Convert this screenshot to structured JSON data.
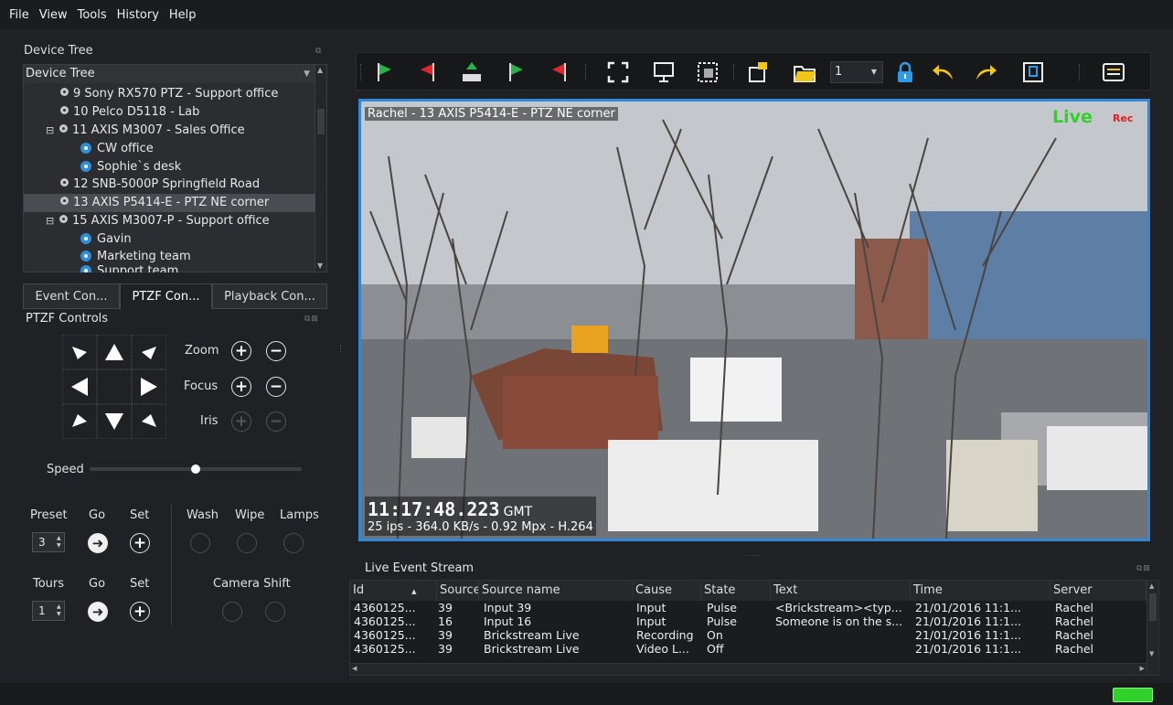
{
  "menu": [
    "File",
    "View",
    "Tools",
    "History",
    "Help"
  ],
  "device_tree": {
    "panel_title": "Device Tree",
    "header": "Device Tree",
    "items": [
      {
        "label": "9 Sony RX570 PTZ - Support office",
        "type": "camera",
        "level": 1
      },
      {
        "label": "10 Pelco D5118 - Lab",
        "type": "camera",
        "level": 1
      },
      {
        "label": "11 AXIS M3007 - Sales Office",
        "type": "camera",
        "level": 1,
        "expanded": true
      },
      {
        "label": "CW office",
        "type": "view",
        "level": 2
      },
      {
        "label": "Sophie`s desk",
        "type": "view",
        "level": 2
      },
      {
        "label": "12 SNB-5000P Springfield Road",
        "type": "camera",
        "level": 1
      },
      {
        "label": "13 AXIS P5414-E - PTZ NE corner",
        "type": "camera",
        "level": 1,
        "selected": true
      },
      {
        "label": "15 AXIS M3007-P - Support office",
        "type": "camera",
        "level": 1,
        "expanded": true
      },
      {
        "label": "Gavin",
        "type": "view",
        "level": 2
      },
      {
        "label": "Marketing team",
        "type": "view",
        "level": 2
      },
      {
        "label": "Support team",
        "type": "view",
        "level": 2
      }
    ]
  },
  "tabs": [
    "Event Con...",
    "PTZF Con...",
    "Playback Con..."
  ],
  "ptzf": {
    "title": "PTZF Controls",
    "zoom": "Zoom",
    "focus": "Focus",
    "iris": "Iris",
    "speed": "Speed",
    "speed_level": 0.5,
    "preset": "Preset",
    "go": "Go",
    "set": "Set",
    "preset_value": "3",
    "tours": "Tours",
    "tours_value": "1",
    "wash": "Wash",
    "wipe": "Wipe",
    "lamps": "Lamps",
    "camera_shift": "Camera Shift"
  },
  "toolbar": {
    "stream_select": "1"
  },
  "video": {
    "overlay_title": "Rachel - 13 AXIS P5414-E - PTZ NE corner",
    "live": "Live",
    "rec": "Rec",
    "time": "11:17:48.223",
    "tz": "GMT",
    "stats": "25 ips  -  364.0 KB/s  -  0.92 Mpx  -  H.264"
  },
  "events": {
    "title": "Live Event Stream",
    "columns": [
      "Id",
      "Source",
      "Source name",
      "Cause",
      "State",
      "Text",
      "Time",
      "Server"
    ],
    "rows": [
      [
        "4360125...",
        "39",
        "Input 39",
        "Input",
        "Pulse",
        "<Brickstream><typ...",
        "21/01/2016 11:1...",
        "Rachel"
      ],
      [
        "4360125...",
        "16",
        "Input 16",
        "Input",
        "Pulse",
        "Someone is on the s...",
        "21/01/2016 11:1...",
        "Rachel"
      ],
      [
        "4360125...",
        "39",
        "Brickstream Live",
        "Recording",
        "On",
        "",
        "21/01/2016 11:1...",
        "Rachel"
      ],
      [
        "4360125...",
        "39",
        "Brickstream Live",
        "Video L...",
        "Off",
        "",
        "21/01/2016 11:1...",
        "Rachel"
      ]
    ]
  },
  "colors": {
    "accent": "#2f89d6",
    "live": "#32d02a",
    "rec": "#e02020",
    "status_ok": "#2fd12a"
  }
}
